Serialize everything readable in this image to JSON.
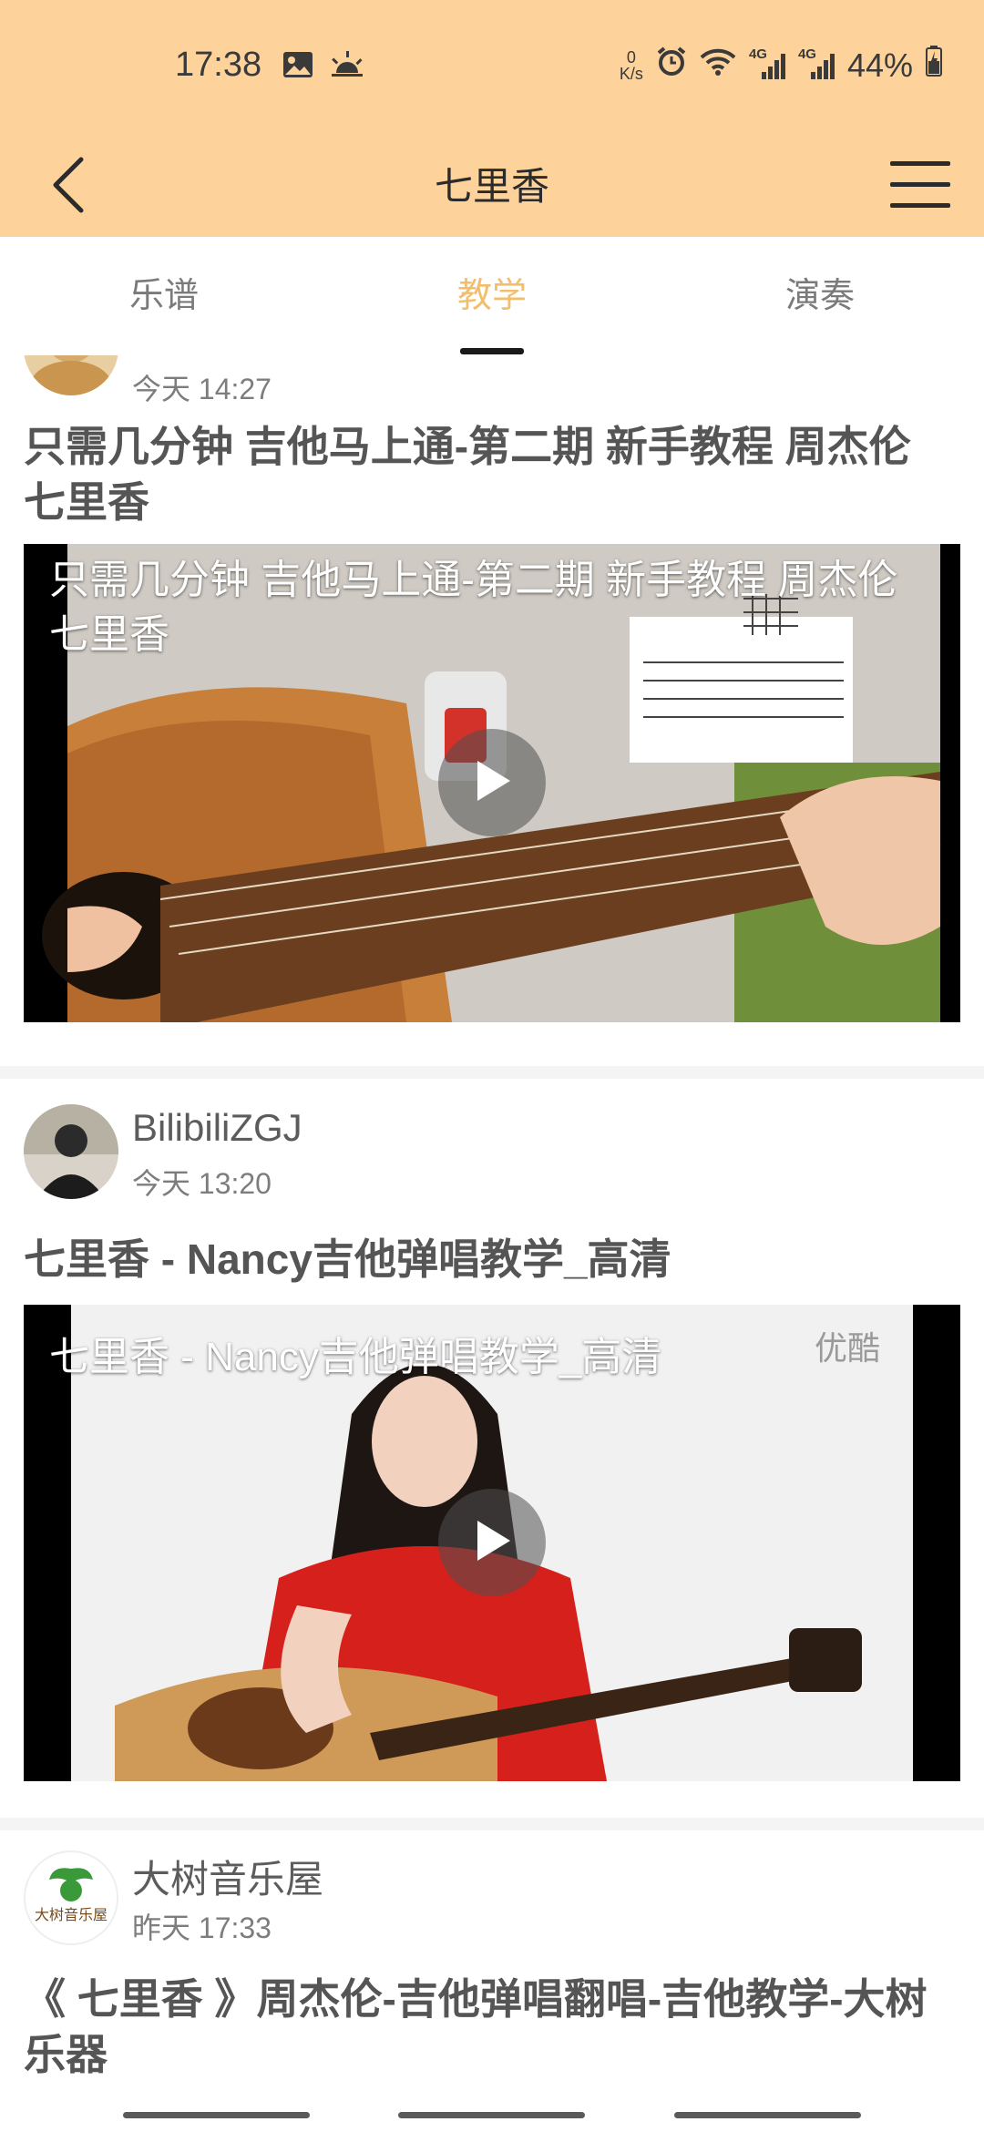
{
  "status_bar": {
    "time": "17:38",
    "net_speed_top": "0",
    "net_speed_unit": "K/s",
    "signal_label_1": "4G",
    "signal_label_2": "4G",
    "battery": "44%"
  },
  "nav": {
    "title": "七里香",
    "back_icon": "chevron-left-icon",
    "menu_icon": "hamburger-menu-icon"
  },
  "tabs": [
    {
      "label": "乐谱",
      "active": false
    },
    {
      "label": "教学",
      "active": true
    },
    {
      "label": "演奏",
      "active": false
    }
  ],
  "colors": {
    "header_bg": "#fdd29b",
    "tab_active": "#f2be6d",
    "tab_inactive": "#7a7a7a"
  },
  "posts": [
    {
      "author": "",
      "time": "今天 14:27",
      "title": "只需几分钟 吉他马上通-第二期 新手教程 周杰伦 七里香",
      "video_overlay_title": "只需几分钟 吉他马上通-第二期 新手教程 周杰伦 七里香"
    },
    {
      "author": "BilibiliZGJ",
      "time": "今天 13:20",
      "title": "七里香 - Nancy吉他弹唱教学_高清",
      "video_overlay_title": "七里香 - Nancy吉他弹唱教学_高清",
      "watermark": "优酷"
    },
    {
      "author": "大树音乐屋",
      "time": "昨天 17:33",
      "title": "《 七里香 》周杰伦-吉他弹唱翻唱-吉他教学-大树乐器",
      "avatar_text": "大树音乐屋"
    }
  ]
}
